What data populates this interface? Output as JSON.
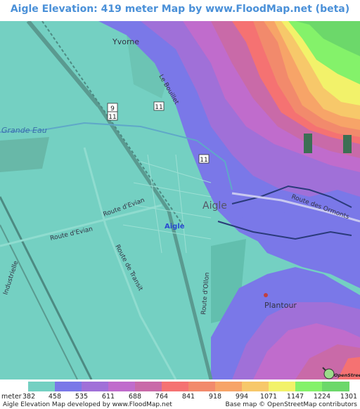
{
  "title": "Aigle Elevation: 419 meter Map by www.FloodMap.net (beta)",
  "map": {
    "place_labels": {
      "town": "Aigle",
      "town_small": "Aigle",
      "yvorne": "Yvorne",
      "plantour": "Plantour",
      "grande_eau": "Grande Eau"
    },
    "road_labels": {
      "route_evian_1": "Route d'Evian",
      "route_evian_2": "Route d'Evian",
      "route_transit": "Route de Transit",
      "route_ollon": "Route d'Ollon",
      "route_ormonts": "Route des Ormonts",
      "le_bouillet": "Le Bouillet",
      "industrielle": "Industrielle",
      "shield_9": "9",
      "shield_11a": "11",
      "shield_11b": "11",
      "shield_11c": "11"
    },
    "osm_logo": "OpenStreetMap"
  },
  "legend": {
    "unit": "meter",
    "values": [
      "382",
      "458",
      "535",
      "611",
      "688",
      "764",
      "841",
      "918",
      "994",
      "1071",
      "1147",
      "1224",
      "1301"
    ],
    "colors": [
      "#74d0c2",
      "#7a78e8",
      "#a070d8",
      "#c06ccc",
      "#c96aa8",
      "#f57272",
      "#f28a6c",
      "#f7a468",
      "#f7c86a",
      "#f2f26a",
      "#84f26a",
      "#6cd86a"
    ],
    "footer_left": "Aigle Elevation Map developed by www.FloodMap.net",
    "footer_right": "Base map © OpenStreetMap contributors"
  }
}
